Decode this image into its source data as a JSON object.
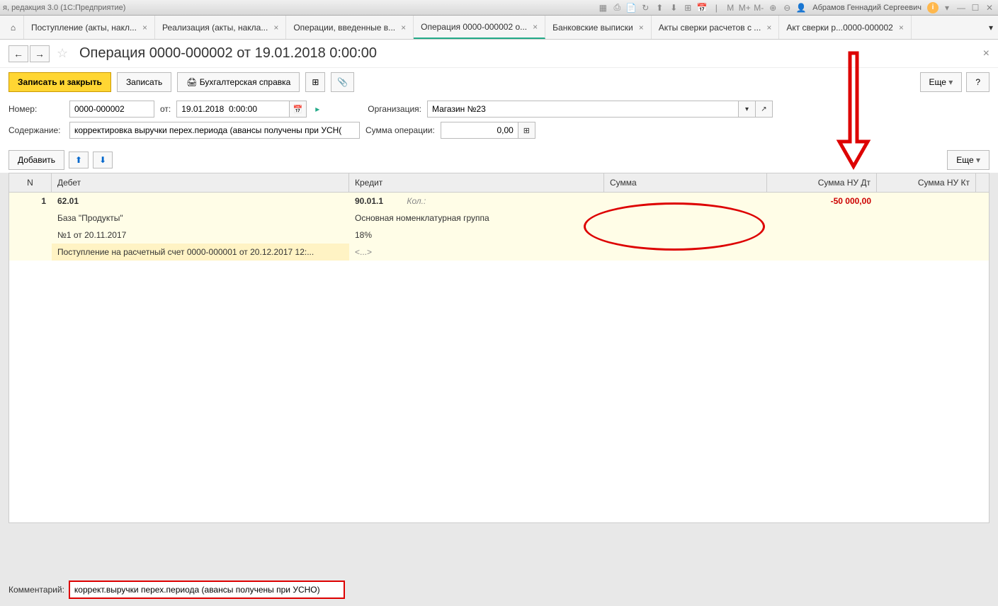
{
  "titlebar": {
    "text": "я, редакция 3.0  (1С:Предприятие)",
    "user": "Абрамов Геннадий Сергеевич",
    "m_labels": [
      "M",
      "M+",
      "M-"
    ]
  },
  "tabs": [
    {
      "label": "Поступление (акты, накл..."
    },
    {
      "label": "Реализация (акты, накла..."
    },
    {
      "label": "Операции, введенные в..."
    },
    {
      "label": "Операция 0000-000002 о...",
      "active": true
    },
    {
      "label": "Банковские выписки"
    },
    {
      "label": "Акты сверки расчетов с ..."
    },
    {
      "label": "Акт сверки р...0000-000002"
    }
  ],
  "header": {
    "title": "Операция 0000-000002 от 19.01.2018 0:00:00"
  },
  "toolbar": {
    "save_close": "Записать и закрыть",
    "save": "Записать",
    "report": "Бухгалтерская справка",
    "more": "Еще",
    "help": "?"
  },
  "form": {
    "number_label": "Номер:",
    "number_value": "0000-000002",
    "from_label": "от:",
    "date_value": "19.01.2018  0:00:00",
    "org_label": "Организация:",
    "org_value": "Магазин №23",
    "content_label": "Содержание:",
    "content_value": "корректировка выручки перех.периода (авансы получены при УСН(",
    "sum_label": "Сумма операции:",
    "sum_value": "0,00"
  },
  "table_toolbar": {
    "add": "Добавить",
    "more": "Еще"
  },
  "table": {
    "headers": {
      "n": "N",
      "debit": "Дебет",
      "credit": "Кредит",
      "sum": "Сумма",
      "nu_dt": "Сумма НУ Дт",
      "nu_kt": "Сумма НУ Кт"
    },
    "rows": [
      {
        "n": "1",
        "debit": "62.01",
        "credit": "90.01.1",
        "credit_extra": "Кол.:",
        "nu_dt": "-50 000,00"
      },
      {
        "debit": "База \"Продукты\"",
        "credit": "Основная номенклатурная группа"
      },
      {
        "debit": "№1 от 20.11.2017",
        "credit": "18%"
      },
      {
        "debit": "Поступление на расчетный счет 0000-000001 от 20.12.2017 12:...",
        "credit": "<...>",
        "highlight": true
      }
    ]
  },
  "comment": {
    "label": "Комментарий:",
    "value": "коррект.выручки перех.периода (авансы получены при УСНО)"
  }
}
